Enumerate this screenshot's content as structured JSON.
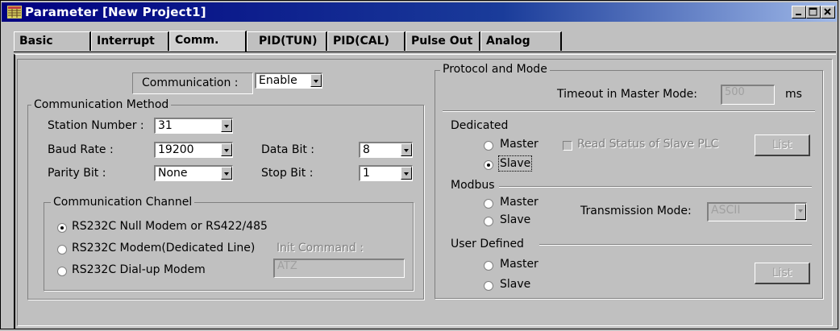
{
  "window": {
    "title": "Parameter [New Project1]"
  },
  "tabs": [
    {
      "label": "Basic"
    },
    {
      "label": "Interrupt"
    },
    {
      "label": "Comm."
    },
    {
      "label": "PID(TUN)"
    },
    {
      "label": "PID(CAL)"
    },
    {
      "label": "Pulse Out"
    },
    {
      "label": "Analog"
    }
  ],
  "comm": {
    "communication_label": "Communication :",
    "communication_value": "Enable"
  },
  "method": {
    "group_label": "Communication Method",
    "station_label": "Station Number :",
    "station_value": "31",
    "baud_label": "Baud Rate :",
    "baud_value": "19200",
    "parity_label": "Parity Bit :",
    "parity_value": "None",
    "databit_label": "Data Bit :",
    "databit_value": "8",
    "stopbit_label": "Stop Bit :",
    "stopbit_value": "1"
  },
  "channel": {
    "group_label": "Communication Channel",
    "options": [
      {
        "label": "RS232C Null Modem or RS422/485"
      },
      {
        "label": "RS232C Modem(Dedicated Line)"
      },
      {
        "label": "RS232C Dial-up Modem"
      }
    ],
    "selected_index": 0,
    "init_label": "Init Command :",
    "init_value": "ATZ"
  },
  "protocol": {
    "group_label": "Protocol and Mode",
    "timeout_label": "Timeout in Master Mode:",
    "timeout_value": "500",
    "timeout_unit": "ms",
    "dedicated": {
      "label": "Dedicated",
      "master": "Master",
      "slave": "Slave",
      "selected": "slave",
      "read_status_label": "Read Status of Slave PLC",
      "list_label": "List"
    },
    "modbus": {
      "label": "Modbus",
      "master": "Master",
      "slave": "Slave",
      "transmission_label": "Transmission Mode:",
      "transmission_value": "ASCII"
    },
    "user_defined": {
      "label": "User Defined",
      "master": "Master",
      "slave": "Slave",
      "list_label": "List"
    }
  }
}
